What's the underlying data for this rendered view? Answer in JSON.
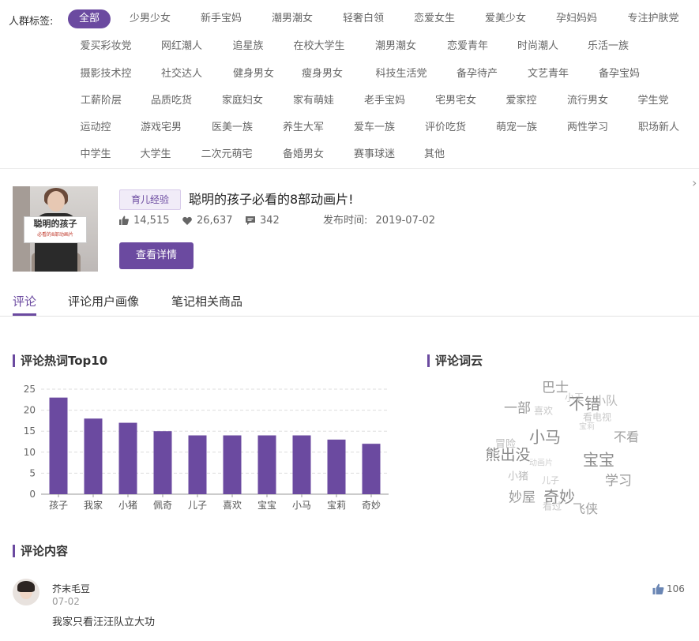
{
  "tag_filter": {
    "label": "人群标签:",
    "rows": [
      [
        "全部",
        "少男少女",
        "新手宝妈",
        "潮男潮女",
        "轻奢白领",
        "恋爱女生",
        "爱美少女",
        "孕妇妈妈",
        "专注护肤党"
      ],
      [
        "爱买彩妆党",
        "网红潮人",
        "追星族",
        "在校大学生",
        "潮男潮女",
        "恋爱青年",
        "时尚潮人",
        "乐活一族"
      ],
      [
        "摄影技术控",
        "社交达人",
        "健身男女",
        "瘦身男女",
        "科技生活党",
        "备孕待产",
        "文艺青年",
        "备孕宝妈"
      ],
      [
        "工薪阶层",
        "品质吃货",
        "家庭妇女",
        "家有萌娃",
        "老手宝妈",
        "宅男宅女",
        "爱家控",
        "流行男女",
        "学生党"
      ],
      [
        "运动控",
        "游戏宅男",
        "医美一族",
        "养生大军",
        "爱车一族",
        "评价吃货",
        "萌宠一族",
        "两性学习",
        "职场新人"
      ],
      [
        "中学生",
        "大学生",
        "二次元萌宅",
        "备婚男女",
        "赛事球迷",
        "其他"
      ]
    ],
    "active": "全部"
  },
  "note": {
    "category": "育儿经验",
    "title": "聪明的孩子必看的8部动画片!",
    "likes": "14,515",
    "favorites": "26,637",
    "comments": "342",
    "publish_label": "发布时间:",
    "publish_date": "2019-07-02",
    "detail_button": "查看详情",
    "thumb_text": "聪明的孩子",
    "thumb_subtext": "必看的8部动画片"
  },
  "tabs": [
    "评论",
    "评论用户画像",
    "笔记相关商品"
  ],
  "hot_words": {
    "heading": "评论热词Top10"
  },
  "chart_data": {
    "type": "bar",
    "title": "评论热词Top10",
    "categories": [
      "孩子",
      "我家",
      "小猪",
      "佩奇",
      "儿子",
      "喜欢",
      "宝宝",
      "小马",
      "宝莉",
      "奇妙"
    ],
    "values": [
      23,
      18,
      17,
      15,
      14,
      14,
      14,
      14,
      13,
      12
    ],
    "ylim": [
      0,
      25
    ],
    "yticks": [
      0,
      5,
      10,
      15,
      20,
      25
    ],
    "grid": true,
    "color": "#6b4aa0"
  },
  "word_cloud": {
    "heading": "评论词云",
    "words": [
      {
        "text": "巴士",
        "size": 17,
        "color": "#9a9a9a"
      },
      {
        "text": "一部",
        "size": 17,
        "color": "#9a9a9a"
      },
      {
        "text": "小队",
        "size": 15,
        "color": "#b5b5b5"
      },
      {
        "text": "小王",
        "size": 12,
        "color": "#c8c8c8"
      },
      {
        "text": "喜欢",
        "size": 12,
        "color": "#c8c8c8"
      },
      {
        "text": "不错",
        "size": 20,
        "color": "#8a8a8a"
      },
      {
        "text": "看电视",
        "size": 12,
        "color": "#c8c8c8"
      },
      {
        "text": "宝莉",
        "size": 10,
        "color": "#d0d0d0"
      },
      {
        "text": "小马",
        "size": 20,
        "color": "#8a8a8a"
      },
      {
        "text": "不看",
        "size": 16,
        "color": "#a0a0a0"
      },
      {
        "text": "冒险",
        "size": 13,
        "color": "#bcbcbc"
      },
      {
        "text": "熊出没",
        "size": 19,
        "color": "#8a8a8a"
      },
      {
        "text": "动画片",
        "size": 10,
        "color": "#d0d0d0"
      },
      {
        "text": "宝宝",
        "size": 20,
        "color": "#8a8a8a"
      },
      {
        "text": "小猪",
        "size": 13,
        "color": "#bcbcbc"
      },
      {
        "text": "儿子",
        "size": 11,
        "color": "#c8c8c8"
      },
      {
        "text": "学习",
        "size": 17,
        "color": "#9a9a9a"
      },
      {
        "text": "妙屋",
        "size": 17,
        "color": "#9a9a9a"
      },
      {
        "text": "奇妙",
        "size": 20,
        "color": "#8a8a8a"
      },
      {
        "text": "看过",
        "size": 12,
        "color": "#c8c8c8"
      },
      {
        "text": "飞侠",
        "size": 16,
        "color": "#a0a0a0"
      }
    ]
  },
  "comments": {
    "heading": "评论内容",
    "items": [
      {
        "user": "芥末毛豆",
        "date": "07-02",
        "text": "我家只看汪汪队立大功",
        "likes": "106"
      }
    ]
  },
  "colors": {
    "accent": "#6b4aa0",
    "accent_light": "#f1ecf8"
  }
}
